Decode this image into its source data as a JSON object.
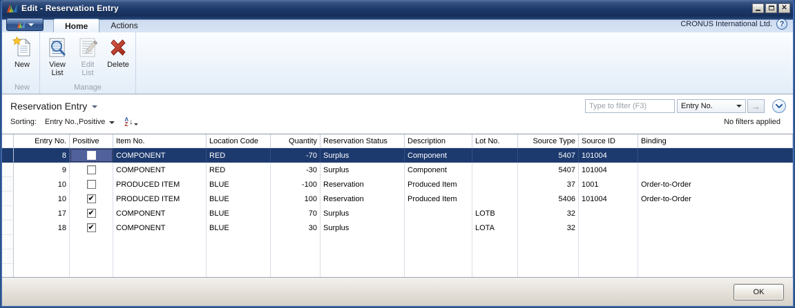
{
  "window": {
    "title": "Edit - Reservation Entry",
    "controls": {
      "minimize": "minimize",
      "maximize": "maximize",
      "close": "close"
    }
  },
  "ribbon": {
    "tabs": [
      {
        "label": "Home",
        "active": true
      },
      {
        "label": "Actions",
        "active": false
      }
    ],
    "company": "CRONUS International Ltd.",
    "help_glyph": "?",
    "groups": [
      {
        "label": "New",
        "buttons": [
          {
            "label": "New",
            "icon": "new-document-icon",
            "enabled": true
          }
        ]
      },
      {
        "label": "Manage",
        "buttons": [
          {
            "label": "View List",
            "icon": "view-list-icon",
            "enabled": true
          },
          {
            "label": "Edit List",
            "icon": "edit-list-icon",
            "enabled": false
          },
          {
            "label": "Delete",
            "icon": "delete-icon",
            "enabled": true
          }
        ]
      }
    ]
  },
  "page": {
    "title": "Reservation Entry",
    "sorting_label": "Sorting:",
    "sorting_value": "Entry No.,Positive",
    "filter": {
      "placeholder": "Type to filter (F3)",
      "column": "Entry No.",
      "go_glyph": "→",
      "status": "No filters applied"
    }
  },
  "grid": {
    "columns": [
      {
        "key": "entry_no",
        "label": "Entry No.",
        "align": "right"
      },
      {
        "key": "positive",
        "label": "Positive",
        "align": "center",
        "type": "checkbox"
      },
      {
        "key": "item_no",
        "label": "Item No.",
        "align": "left"
      },
      {
        "key": "location_code",
        "label": "Location Code",
        "align": "left"
      },
      {
        "key": "quantity",
        "label": "Quantity",
        "align": "right"
      },
      {
        "key": "reservation_status",
        "label": "Reservation Status",
        "align": "left"
      },
      {
        "key": "description",
        "label": "Description",
        "align": "left"
      },
      {
        "key": "lot_no",
        "label": "Lot No.",
        "align": "left"
      },
      {
        "key": "source_type",
        "label": "Source Type",
        "align": "right"
      },
      {
        "key": "source_id",
        "label": "Source ID",
        "align": "left"
      },
      {
        "key": "binding",
        "label": "Binding",
        "align": "left",
        "fill": true
      }
    ],
    "rows": [
      {
        "selected": true,
        "entry_no": "8",
        "positive": false,
        "item_no": "COMPONENT",
        "location_code": "RED",
        "quantity": "-70",
        "reservation_status": "Surplus",
        "description": "Component",
        "lot_no": "",
        "source_type": "5407",
        "source_id": "101004",
        "binding": ""
      },
      {
        "selected": false,
        "entry_no": "9",
        "positive": false,
        "item_no": "COMPONENT",
        "location_code": "RED",
        "quantity": "-30",
        "reservation_status": "Surplus",
        "description": "Component",
        "lot_no": "",
        "source_type": "5407",
        "source_id": "101004",
        "binding": ""
      },
      {
        "selected": false,
        "entry_no": "10",
        "positive": false,
        "item_no": "PRODUCED ITEM",
        "location_code": "BLUE",
        "quantity": "-100",
        "reservation_status": "Reservation",
        "description": "Produced Item",
        "lot_no": "",
        "source_type": "37",
        "source_id": "1001",
        "binding": "Order-to-Order"
      },
      {
        "selected": false,
        "entry_no": "10",
        "positive": true,
        "item_no": "PRODUCED ITEM",
        "location_code": "BLUE",
        "quantity": "100",
        "reservation_status": "Reservation",
        "description": "Produced Item",
        "lot_no": "",
        "source_type": "5406",
        "source_id": "101004",
        "binding": "Order-to-Order"
      },
      {
        "selected": false,
        "entry_no": "17",
        "positive": true,
        "item_no": "COMPONENT",
        "location_code": "BLUE",
        "quantity": "70",
        "reservation_status": "Surplus",
        "description": "",
        "lot_no": "LOTB",
        "source_type": "32",
        "source_id": "",
        "binding": ""
      },
      {
        "selected": false,
        "entry_no": "18",
        "positive": true,
        "item_no": "COMPONENT",
        "location_code": "BLUE",
        "quantity": "30",
        "reservation_status": "Surplus",
        "description": "",
        "lot_no": "LOTA",
        "source_type": "32",
        "source_id": "",
        "binding": ""
      }
    ],
    "checkbox_glyph": "✔"
  },
  "footer": {
    "ok_label": "OK"
  },
  "icons": {
    "dynamics-logo-icon": "colored sail triangles",
    "new-document-icon": "page with yellow star",
    "view-list-icon": "list page with magnifier",
    "edit-list-icon": "list page with pencil",
    "delete-icon": "red X",
    "sort-az-icon": "A over Z with down arrow",
    "help-icon": "circled question mark",
    "chevron-down-icon": "expand filter pane",
    "go-arrow-icon": "apply filter arrow"
  },
  "colors": {
    "titlebar": "#1d3a6b",
    "window_border": "#3e68ac",
    "selection_row": "#1d3a6f",
    "selection_focus_cell": "#50619c",
    "ribbon_bg": "#eef4fb",
    "delete_red": "#c23325",
    "footer_gray": "#d6d2c8"
  }
}
